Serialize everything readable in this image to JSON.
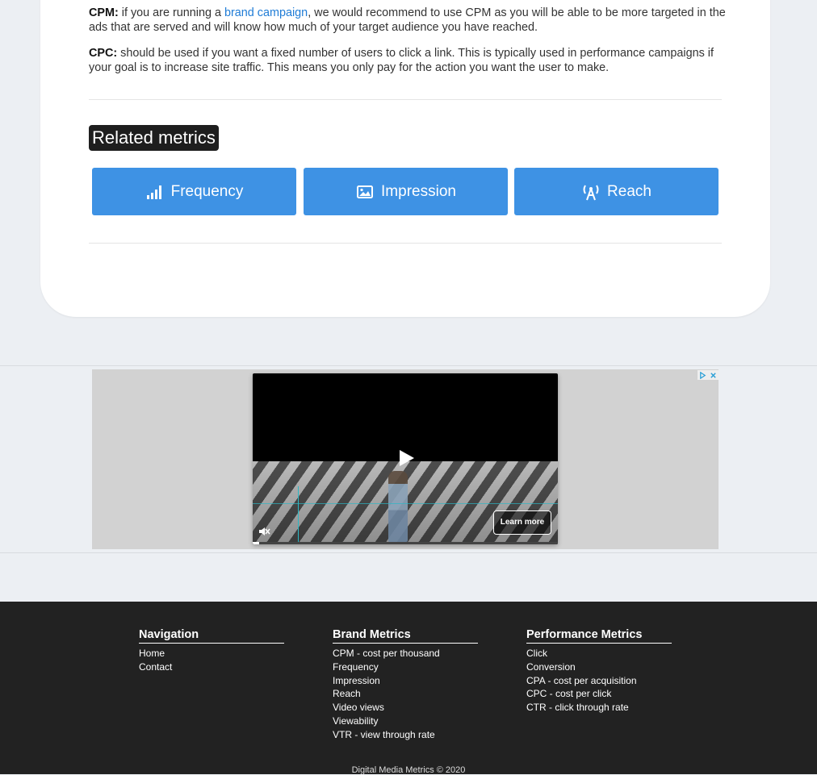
{
  "content": {
    "cpm_label": "CPM:",
    "cpm_text_before": " if you are running a ",
    "cpm_link": "brand campaign",
    "cpm_text_after": ", we would recommend to use CPM as you will be able to be more targeted in the ads that are served and will know how much of your target audience you have reached.",
    "cpc_label": "CPC:",
    "cpc_text": " should be used if you want a fixed number of users to click a link. This is typically used in performance campaigns if your goal is to increase site traffic. This means you only pay for the action you want the user to make."
  },
  "related": {
    "title": "Related metrics",
    "buttons": [
      {
        "label": "Frequency",
        "icon": "signal-bars-icon"
      },
      {
        "label": "Impression",
        "icon": "image-icon"
      },
      {
        "label": "Reach",
        "icon": "broadcast-tower-icon"
      }
    ]
  },
  "ad": {
    "learn_more": "Learn more",
    "progress": 0.02
  },
  "footer": {
    "navigation": {
      "heading": "Navigation",
      "links": [
        "Home",
        "Contact"
      ]
    },
    "brand": {
      "heading": "Brand Metrics",
      "links": [
        "CPM - cost per thousand",
        "Frequency",
        "Impression",
        "Reach",
        "Video views",
        "Viewability",
        "VTR - view through rate"
      ]
    },
    "performance": {
      "heading": "Performance Metrics",
      "links": [
        "Click",
        "Conversion",
        "CPA - cost per acquisition",
        "CPC - cost per click",
        "CTR - click through rate"
      ]
    },
    "copyright": "Digital Media Metrics © 2020"
  },
  "colors": {
    "button": "#3e92e4",
    "link": "#1f7cd6",
    "footer_bg": "#222222",
    "page_bg": "#eceff3"
  }
}
